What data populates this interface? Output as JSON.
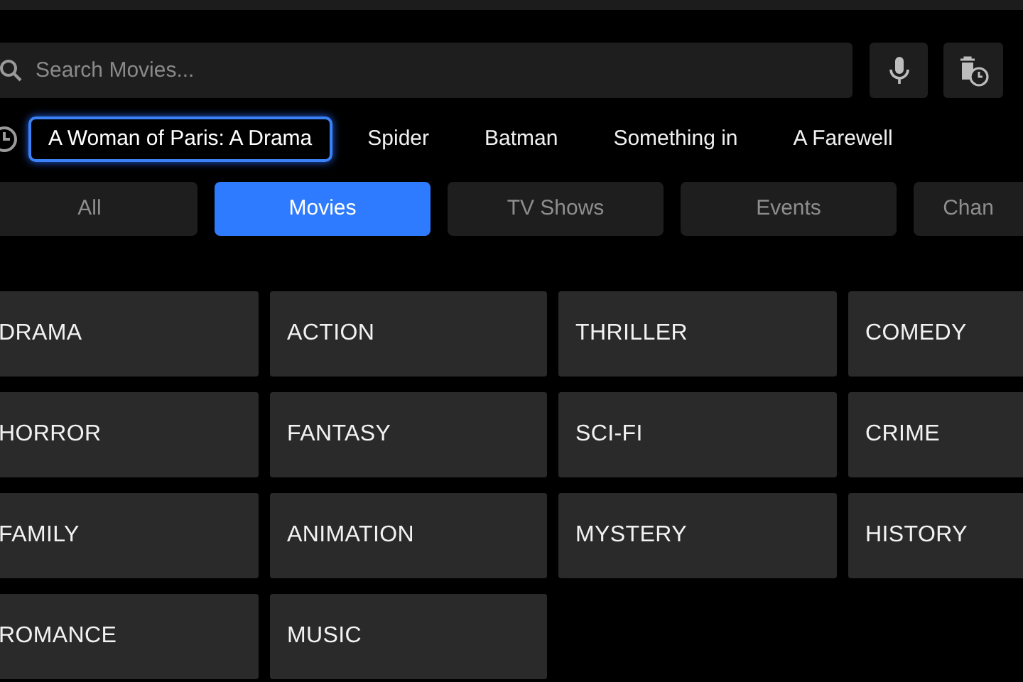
{
  "search": {
    "placeholder": "Search Movies..."
  },
  "recent_searches": [
    {
      "label": "A Woman of Paris: A Drama",
      "selected": true
    },
    {
      "label": "Spider",
      "selected": false
    },
    {
      "label": "Batman",
      "selected": false
    },
    {
      "label": "Something in",
      "selected": false
    },
    {
      "label": "A Farewell",
      "selected": false
    }
  ],
  "filter_tabs": [
    {
      "label": "All",
      "selected": false
    },
    {
      "label": "Movies",
      "selected": true
    },
    {
      "label": "TV Shows",
      "selected": false
    },
    {
      "label": "Events",
      "selected": false
    },
    {
      "label": "Chan",
      "selected": false
    }
  ],
  "genres": [
    {
      "label": "DRAMA"
    },
    {
      "label": "ACTION"
    },
    {
      "label": "THRILLER"
    },
    {
      "label": "COMEDY"
    },
    {
      "label": "HORROR"
    },
    {
      "label": "FANTASY"
    },
    {
      "label": "SCI-FI"
    },
    {
      "label": "CRIME"
    },
    {
      "label": "FAMILY"
    },
    {
      "label": "ANIMATION"
    },
    {
      "label": "MYSTERY"
    },
    {
      "label": "HISTORY"
    },
    {
      "label": "ROMANCE"
    },
    {
      "label": "MUSIC"
    }
  ]
}
